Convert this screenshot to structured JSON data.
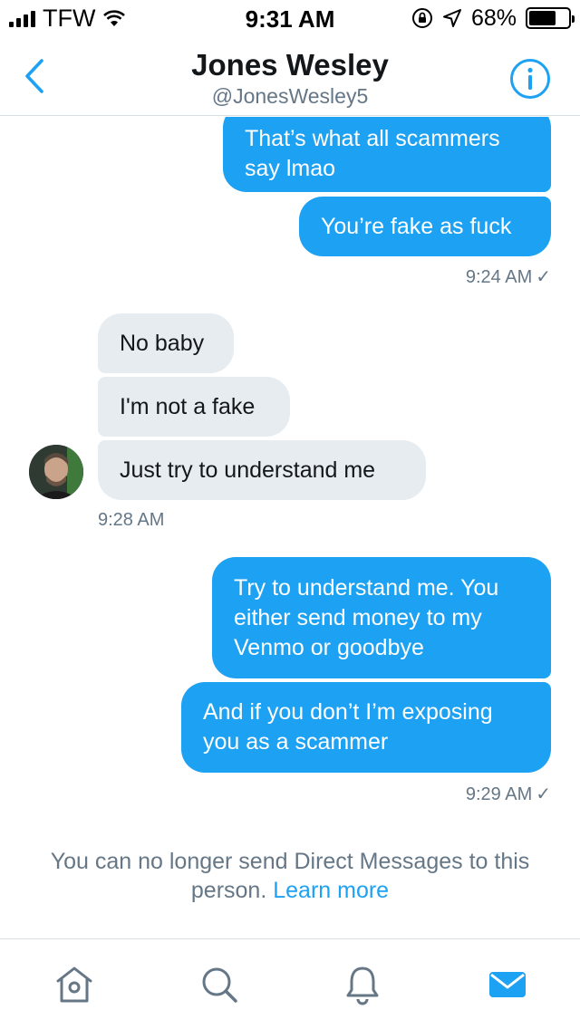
{
  "status_bar": {
    "carrier": "TFW",
    "time": "9:31 AM",
    "battery": "68%",
    "battery_level": 0.68
  },
  "header": {
    "name": "Jones Wesley",
    "handle": "@JonesWesley5"
  },
  "messages": {
    "m1": {
      "lines": [
        "That’s what all scammers",
        "say lmao"
      ]
    },
    "m2": {
      "lines": [
        "You’re fake as fuck"
      ]
    },
    "t1": {
      "time": "9:24 AM",
      "check": "✓"
    },
    "m3": {
      "lines": [
        "No baby"
      ]
    },
    "m4": {
      "lines": [
        "I'm not a fake"
      ]
    },
    "m5": {
      "lines": [
        "Just try to understand me"
      ]
    },
    "t2": {
      "time": "9:28 AM"
    },
    "m6": {
      "lines": [
        "Try to understand me. You",
        "either send money to my",
        "Venmo or goodbye"
      ]
    },
    "m7": {
      "lines": [
        "And if you don’t I’m exposing",
        "you as a scammer"
      ]
    },
    "t3": {
      "time": "9:29 AM",
      "check": "✓"
    }
  },
  "notice": {
    "line1": "You can no longer send Direct Messages to this",
    "line2_prefix": "person.",
    "link": "Learn more"
  },
  "tabs": [
    {
      "icon": "home-icon"
    },
    {
      "icon": "search-icon"
    },
    {
      "icon": "notifications-icon"
    },
    {
      "icon": "messages-icon",
      "active": true
    }
  ],
  "colors": {
    "accent": "#1da1f2",
    "incoming_bubble": "#e6ecf0",
    "secondary_text": "#657786"
  }
}
